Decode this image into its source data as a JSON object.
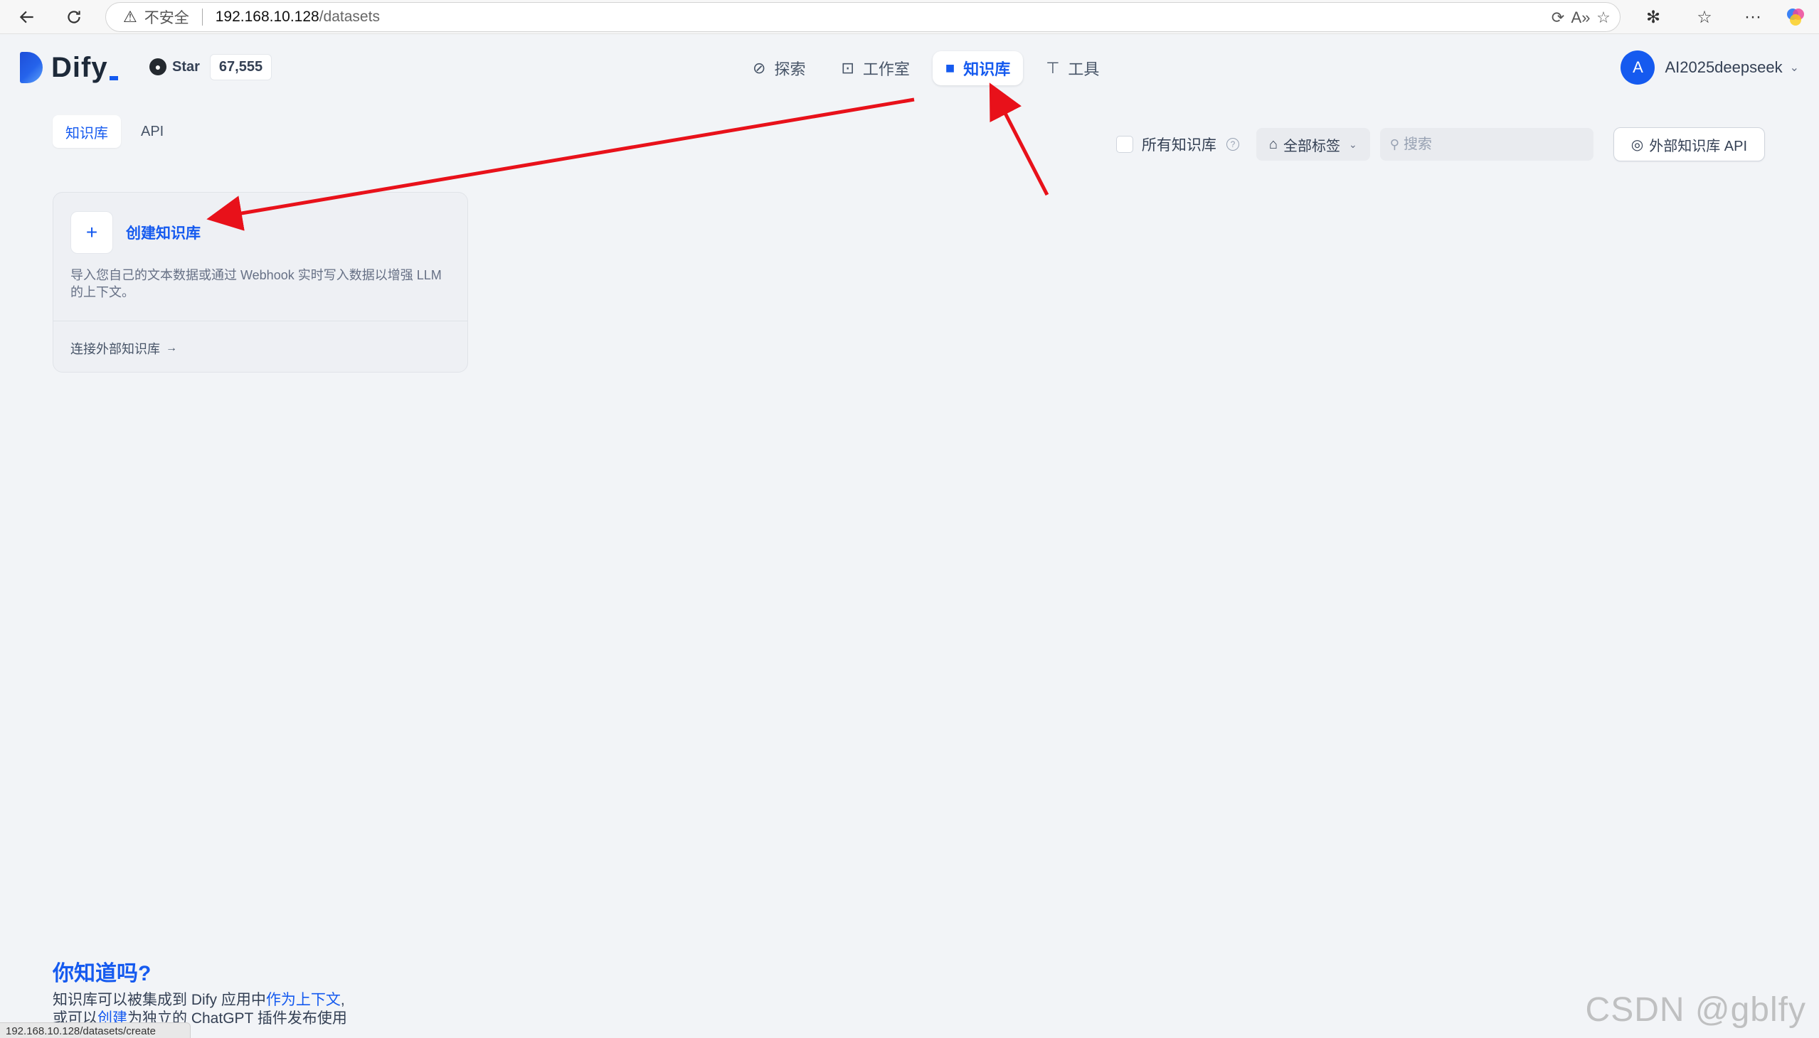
{
  "browser": {
    "security_label": "不安全",
    "url_host": "192.168.10.128",
    "url_path": "/datasets"
  },
  "header": {
    "brand": "Dify",
    "github_star_label": "Star",
    "github_star_count": "67,555",
    "nav": [
      {
        "label": "探索",
        "icon": "compass-icon",
        "active": false
      },
      {
        "label": "工作室",
        "icon": "robot-icon",
        "active": false
      },
      {
        "label": "知识库",
        "icon": "book-icon",
        "active": true
      },
      {
        "label": "工具",
        "icon": "hammer-icon",
        "active": false
      }
    ],
    "user": {
      "initial": "A",
      "name": "AI2025deepseek"
    }
  },
  "subtabs": [
    {
      "label": "知识库",
      "active": true
    },
    {
      "label": "API",
      "active": false
    }
  ],
  "toolbar": {
    "all_datasets_label": "所有知识库",
    "all_datasets_checked": false,
    "tags_label": "全部标签",
    "search_placeholder": "搜索",
    "external_api_label": "外部知识库 API"
  },
  "create_card": {
    "plus": "+",
    "title": "创建知识库",
    "description": "导入您自己的文本数据或通过 Webhook 实时写入数据以增强 LLM 的上下文。",
    "connect_link": "连接外部知识库"
  },
  "tip": {
    "title": "你知道吗?",
    "line1_prefix": "知识库可以被集成到 Dify 应用中",
    "line1_link": "作为上下文",
    "line1_suffix": ",",
    "line2_prefix": "或可以",
    "line2_link": "创建",
    "line2_suffix": "为独立的 ChatGPT 插件发布使用"
  },
  "status_bar": "192.168.10.128/datasets/create",
  "watermark": "CSDN @gblfy",
  "colors": {
    "accent": "#155aef",
    "annotation": "#e8111a",
    "background": "#f2f4f7"
  }
}
